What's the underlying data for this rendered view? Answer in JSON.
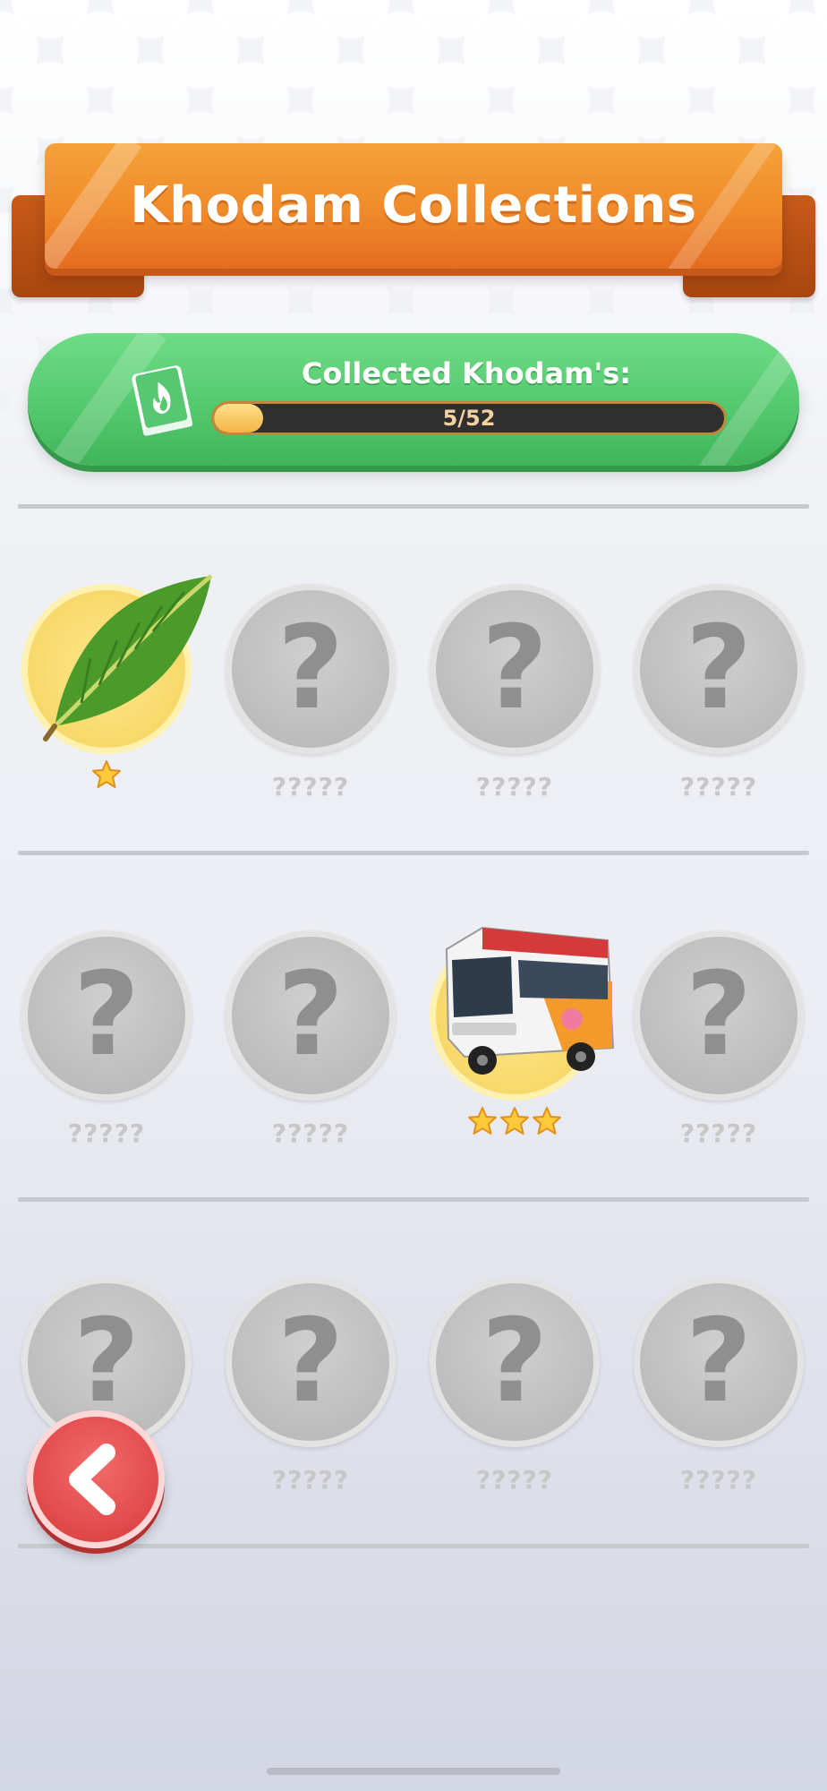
{
  "header": {
    "title": "Khodam Collections"
  },
  "progress": {
    "label": "Collected Khodam's:",
    "text": "5/52",
    "collected": 5,
    "total": 52,
    "fraction": 0.096
  },
  "icons": {
    "book": "fire-book-icon",
    "back": "chevron-left-icon",
    "question": "question-mark-icon",
    "star": "star-icon"
  },
  "colors": {
    "banner": "#f08a2a",
    "progress_panel": "#52c76c",
    "back_button": "#e14949",
    "locked_circle": "#bdbdbd",
    "unlocked_circle": "#f7d86a"
  },
  "items": [
    {
      "name": "",
      "unlocked": true,
      "stars": 1,
      "image": "banana-leaf"
    },
    {
      "name": "?????",
      "unlocked": false
    },
    {
      "name": "?????",
      "unlocked": false
    },
    {
      "name": "?????",
      "unlocked": false
    },
    {
      "name": "?????",
      "unlocked": false
    },
    {
      "name": "?????",
      "unlocked": false
    },
    {
      "name": "",
      "unlocked": true,
      "stars": 3,
      "image": "bus"
    },
    {
      "name": "?????",
      "unlocked": false
    },
    {
      "name": "",
      "unlocked": false
    },
    {
      "name": "?????",
      "unlocked": false
    },
    {
      "name": "?????",
      "unlocked": false
    },
    {
      "name": "?????",
      "unlocked": false
    }
  ],
  "question_mark": "?"
}
